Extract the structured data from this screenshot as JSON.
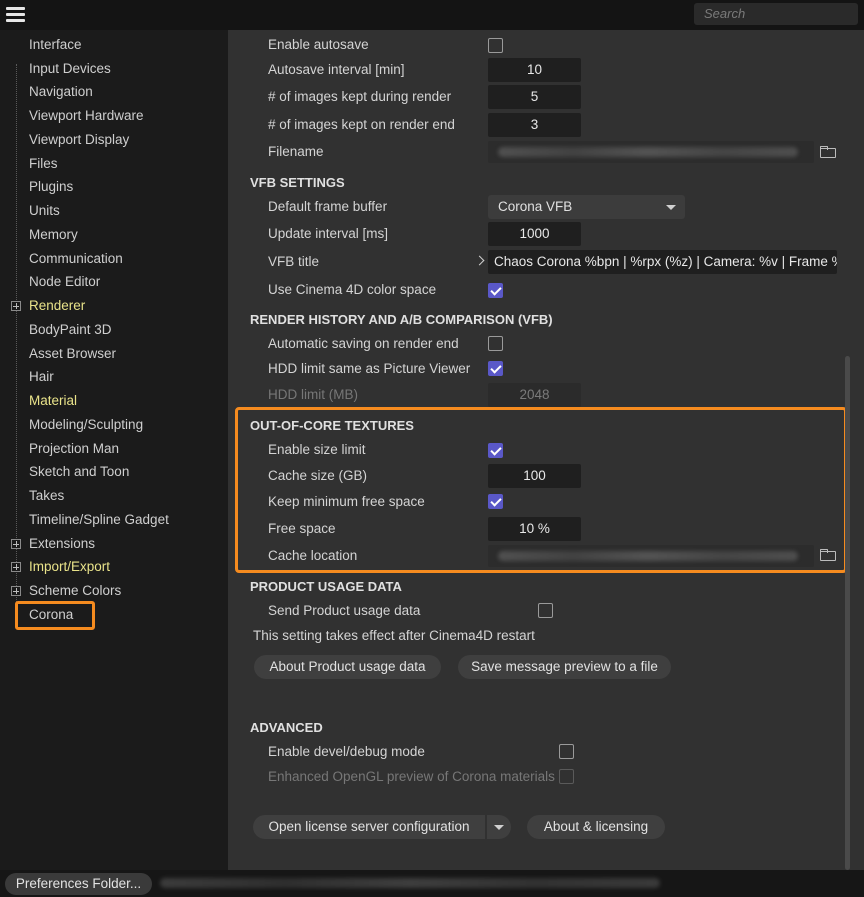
{
  "search": {
    "placeholder": "Search"
  },
  "sidebar": {
    "items": [
      {
        "label": "Interface"
      },
      {
        "label": "Input Devices"
      },
      {
        "label": "Navigation"
      },
      {
        "label": "Viewport Hardware"
      },
      {
        "label": "Viewport Display"
      },
      {
        "label": "Files"
      },
      {
        "label": "Plugins"
      },
      {
        "label": "Units"
      },
      {
        "label": "Memory"
      },
      {
        "label": "Communication"
      },
      {
        "label": "Node Editor"
      },
      {
        "label": "Renderer"
      },
      {
        "label": "BodyPaint 3D"
      },
      {
        "label": "Asset Browser"
      },
      {
        "label": "Hair"
      },
      {
        "label": "Material"
      },
      {
        "label": "Modeling/Sculpting"
      },
      {
        "label": "Projection Man"
      },
      {
        "label": "Sketch and Toon"
      },
      {
        "label": "Takes"
      },
      {
        "label": "Timeline/Spline Gadget"
      },
      {
        "label": "Extensions"
      },
      {
        "label": "Import/Export"
      },
      {
        "label": "Scheme Colors"
      },
      {
        "label": "Corona"
      }
    ],
    "selected": "Corona"
  },
  "autosave": {
    "enable_label": "Enable autosave",
    "enable_checked": false,
    "interval_label": "Autosave interval [min]",
    "interval_value": "10",
    "kept_during_label": "# of images kept during render",
    "kept_during_value": "5",
    "kept_end_label": "# of images kept on render end",
    "kept_end_value": "3",
    "filename_label": "Filename"
  },
  "vfb": {
    "section": "VFB SETTINGS",
    "frame_buffer_label": "Default frame buffer",
    "frame_buffer_value": "Corona VFB",
    "update_label": "Update interval [ms]",
    "update_value": "1000",
    "title_label": "VFB title",
    "title_value": "Chaos Corona %bpn | %rpx (%z) | Camera: %v | Frame %",
    "colorspace_label": "Use Cinema 4D color space",
    "colorspace_checked": true
  },
  "history": {
    "section": "RENDER HISTORY AND A/B COMPARISON (VFB)",
    "autosave_label": "Automatic saving on render end",
    "autosave_checked": false,
    "hdd_same_label": "HDD limit same as Picture Viewer",
    "hdd_same_checked": true,
    "hdd_limit_label": "HDD limit (MB)",
    "hdd_limit_value": "2048"
  },
  "ooc": {
    "section": "OUT-OF-CORE TEXTURES",
    "size_limit_label": "Enable size limit",
    "size_limit_checked": true,
    "cache_size_label": "Cache size (GB)",
    "cache_size_value": "100",
    "keep_free_label": "Keep minimum free space",
    "keep_free_checked": true,
    "free_space_label": "Free space",
    "free_space_value": "10 %",
    "cache_location_label": "Cache location"
  },
  "usage": {
    "section": "PRODUCT USAGE DATA",
    "send_label": "Send Product usage data",
    "send_checked": false,
    "note": "This setting takes effect after Cinema4D restart",
    "about_button": "About Product usage data",
    "save_button": "Save message preview to a file"
  },
  "advanced": {
    "section": "ADVANCED",
    "debug_label": "Enable devel/debug mode",
    "debug_checked": false,
    "opengl_label": "Enhanced OpenGL preview of Corona materials",
    "opengl_checked": false,
    "license_button": "Open license server configuration",
    "about_button": "About & licensing"
  },
  "bottom": {
    "prefs_button": "Preferences Folder..."
  },
  "colors": {
    "accent": "#f58b1f",
    "check": "#5a58c8",
    "highlight_text": "#e9e38a"
  }
}
